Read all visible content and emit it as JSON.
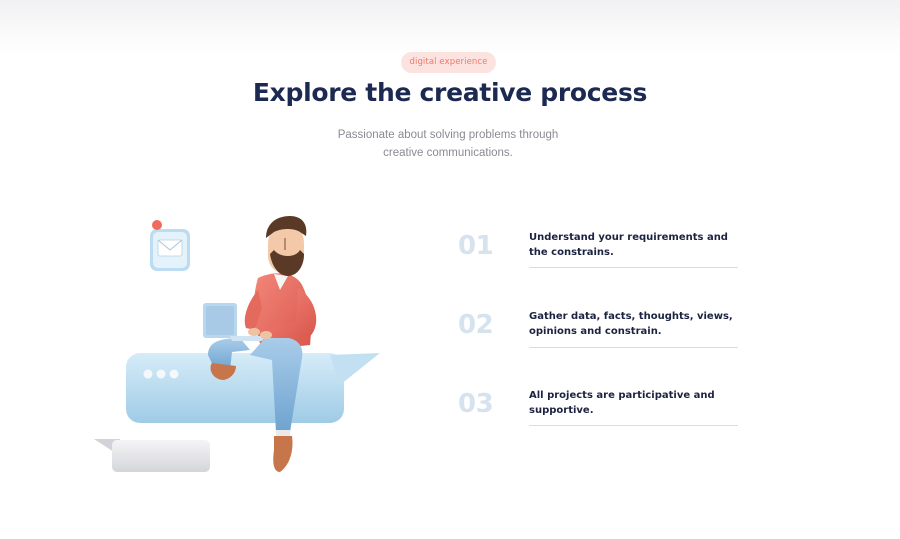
{
  "header": {
    "badge": "digital experience",
    "title": "Explore the creative process",
    "subtitle": "Passionate about solving problems through creative communications."
  },
  "illustration": {
    "description_icons": [
      "mail-icon",
      "chat-bubble-icon",
      "laptop-icon"
    ]
  },
  "steps": [
    {
      "number": "01",
      "text": "Understand your requirements and the constrains."
    },
    {
      "number": "02",
      "text": "Gather data, facts, thoughts, views, opinions and constrain."
    },
    {
      "number": "03",
      "text": "All projects are participative and supportive."
    }
  ],
  "colors": {
    "badge_bg": "#fde3df",
    "badge_text": "#ef7a6b",
    "title": "#1c2a52",
    "step_number": "#d7e2ef"
  }
}
